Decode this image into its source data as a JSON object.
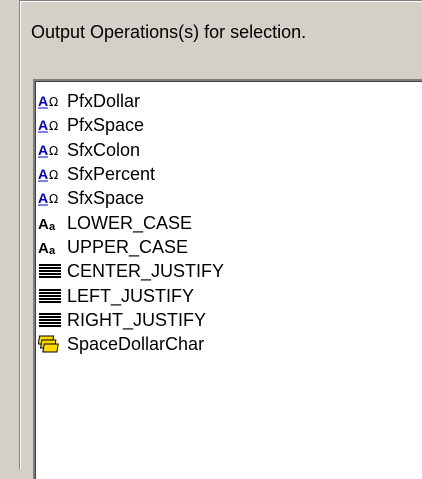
{
  "caption": "Output Operations(s) for selection.",
  "list": {
    "items": [
      {
        "label": "PfxDollar",
        "icon": "text-format-icon"
      },
      {
        "label": "PfxSpace",
        "icon": "text-format-icon"
      },
      {
        "label": "SfxColon",
        "icon": "text-format-icon"
      },
      {
        "label": "SfxPercent",
        "icon": "text-format-icon"
      },
      {
        "label": "SfxSpace",
        "icon": "text-format-icon"
      },
      {
        "label": "LOWER_CASE",
        "icon": "case-icon"
      },
      {
        "label": "UPPER_CASE",
        "icon": "case-icon"
      },
      {
        "label": "CENTER_JUSTIFY",
        "icon": "justify-icon"
      },
      {
        "label": "LEFT_JUSTIFY",
        "icon": "justify-icon"
      },
      {
        "label": "RIGHT_JUSTIFY",
        "icon": "justify-icon"
      },
      {
        "label": "SpaceDollarChar",
        "icon": "stacked-layers-icon"
      }
    ]
  },
  "colors": {
    "background": "#d4d0c8",
    "list_background": "#ffffff",
    "text_format_icon_blue": "#0000cc",
    "stacked_icon_yellow": "#ffd800"
  }
}
